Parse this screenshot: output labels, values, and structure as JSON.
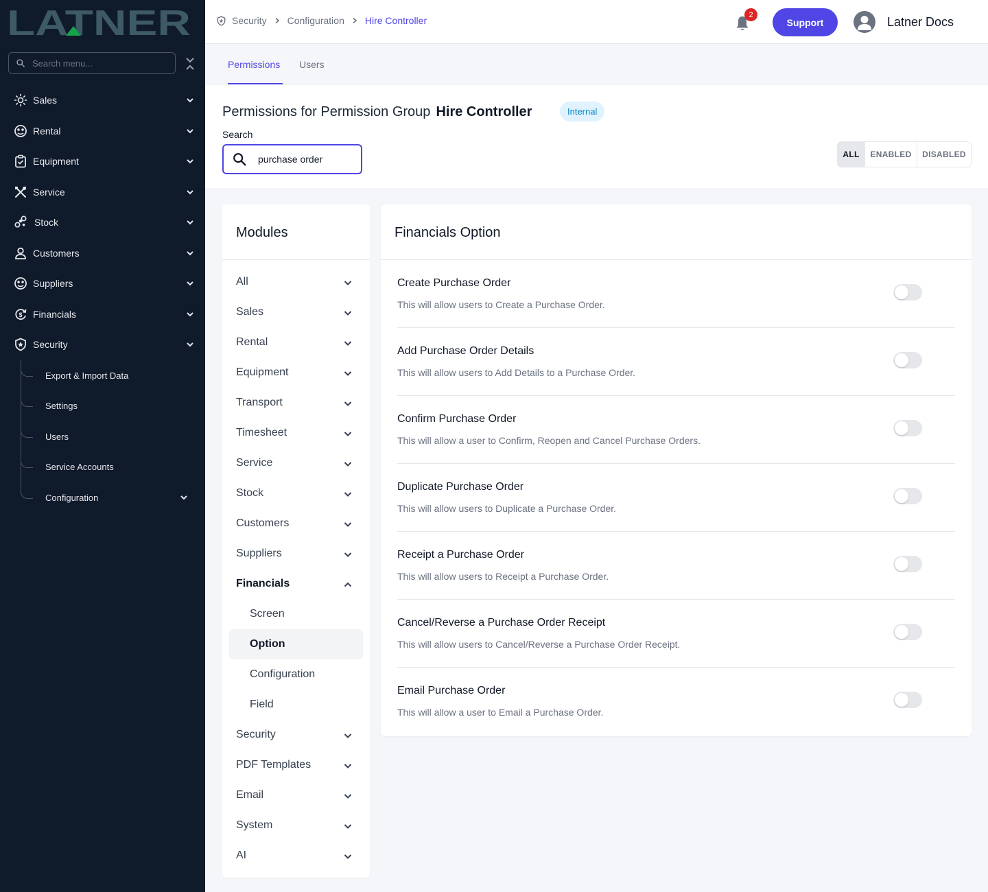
{
  "sidebar": {
    "logo_text": "LATNER",
    "search_placeholder": "Search menu...",
    "items": [
      {
        "label": "Sales"
      },
      {
        "label": "Rental"
      },
      {
        "label": "Equipment"
      },
      {
        "label": "Service"
      },
      {
        "label": "Stock"
      },
      {
        "label": "Customers"
      },
      {
        "label": "Suppliers"
      },
      {
        "label": "Financials"
      },
      {
        "label": "Security"
      }
    ],
    "security_children": [
      {
        "label": "Export & Import Data"
      },
      {
        "label": "Settings"
      },
      {
        "label": "Users"
      },
      {
        "label": "Service Accounts"
      },
      {
        "label": "Configuration"
      }
    ]
  },
  "header": {
    "breadcrumb": [
      "Security",
      "Configuration",
      "Hire Controller"
    ],
    "notification_count": "2",
    "support_label": "Support",
    "user_name": "Latner Docs"
  },
  "tabs": [
    {
      "label": "Permissions",
      "active": true
    },
    {
      "label": "Users",
      "active": false
    }
  ],
  "page": {
    "title_prefix": "Permissions for Permission Group",
    "group_name": "Hire Controller",
    "badge": "Internal",
    "search_label": "Search",
    "search_value": "purchase order",
    "filters": [
      {
        "label": "ALL",
        "active": true
      },
      {
        "label": "ENABLED",
        "active": false
      },
      {
        "label": "DISABLED",
        "active": false
      }
    ]
  },
  "modules": {
    "title": "Modules",
    "items": [
      {
        "label": "All"
      },
      {
        "label": "Sales"
      },
      {
        "label": "Rental"
      },
      {
        "label": "Equipment"
      },
      {
        "label": "Transport"
      },
      {
        "label": "Timesheet"
      },
      {
        "label": "Service"
      },
      {
        "label": "Stock"
      },
      {
        "label": "Customers"
      },
      {
        "label": "Suppliers"
      },
      {
        "label": "Financials",
        "expanded": true
      },
      {
        "label": "Security"
      },
      {
        "label": "PDF Templates"
      },
      {
        "label": "Email"
      },
      {
        "label": "System"
      },
      {
        "label": "AI"
      }
    ],
    "financials_children": [
      {
        "label": "Screen"
      },
      {
        "label": "Option",
        "active": true
      },
      {
        "label": "Configuration"
      },
      {
        "label": "Field"
      }
    ]
  },
  "options": {
    "title": "Financials Option",
    "rows": [
      {
        "title": "Create Purchase Order",
        "description": "This will allow users to Create a Purchase Order.",
        "enabled": false
      },
      {
        "title": "Add Purchase Order Details",
        "description": "This will allow users to Add Details to a Purchase Order.",
        "enabled": false
      },
      {
        "title": "Confirm Purchase Order",
        "description": "This will allow a user to Confirm, Reopen and Cancel Purchase Orders.",
        "enabled": false
      },
      {
        "title": "Duplicate Purchase Order",
        "description": "This will allow users to Duplicate a Purchase Order.",
        "enabled": false
      },
      {
        "title": "Receipt a Purchase Order",
        "description": "This will allow users to Receipt a Purchase Order.",
        "enabled": false
      },
      {
        "title": "Cancel/Reverse a Purchase Order Receipt",
        "description": "This will allow users to Cancel/Reverse a Purchase Order Receipt.",
        "enabled": false
      },
      {
        "title": "Email Purchase Order",
        "description": "This will allow a user to Email a Purchase Order.",
        "enabled": false
      }
    ]
  },
  "colors": {
    "sidebar_bg": "#0f1a2b",
    "logo": "#3d5a66",
    "logo_accent": "#16a34a",
    "accent": "#4f46e5",
    "badge_red": "#dc2626"
  }
}
